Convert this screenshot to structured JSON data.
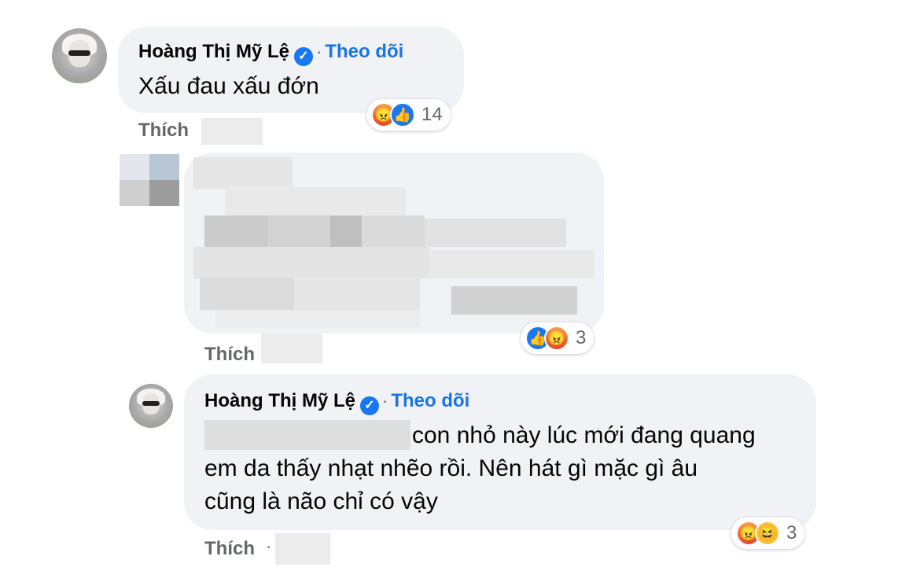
{
  "comment1": {
    "author": "Hoàng Thị Mỹ Lệ",
    "follow_label": "Theo dõi",
    "separator": "·",
    "text": "Xấu đau xấu đớn",
    "reactions": {
      "icons": [
        "angry-icon",
        "like-icon"
      ],
      "count": "14"
    },
    "like_label": "Thích"
  },
  "comment2": {
    "author_hidden": true,
    "reactions": {
      "icons": [
        "like-icon",
        "angry-icon"
      ],
      "count": "3"
    },
    "like_label": "Thích"
  },
  "comment3": {
    "author": "Hoàng Thị Mỹ Lệ",
    "follow_label": "Theo dõi",
    "separator": "·",
    "text_line1": "con nhỏ này lúc mới đang quang",
    "text_line2": "em da thấy nhạt nhẽo rồi. Nên hát gì mặc gì âu",
    "text_line3": "cũng là não chỉ có vậy",
    "reactions": {
      "icons": [
        "angry-icon",
        "haha-icon"
      ],
      "count": "3"
    },
    "like_label": "Thích"
  },
  "colors": {
    "bubble_bg": "#f0f2f5",
    "follow_blue": "#1b74e4",
    "meta_gray": "#65676b",
    "verified_blue": "#1877f2"
  }
}
